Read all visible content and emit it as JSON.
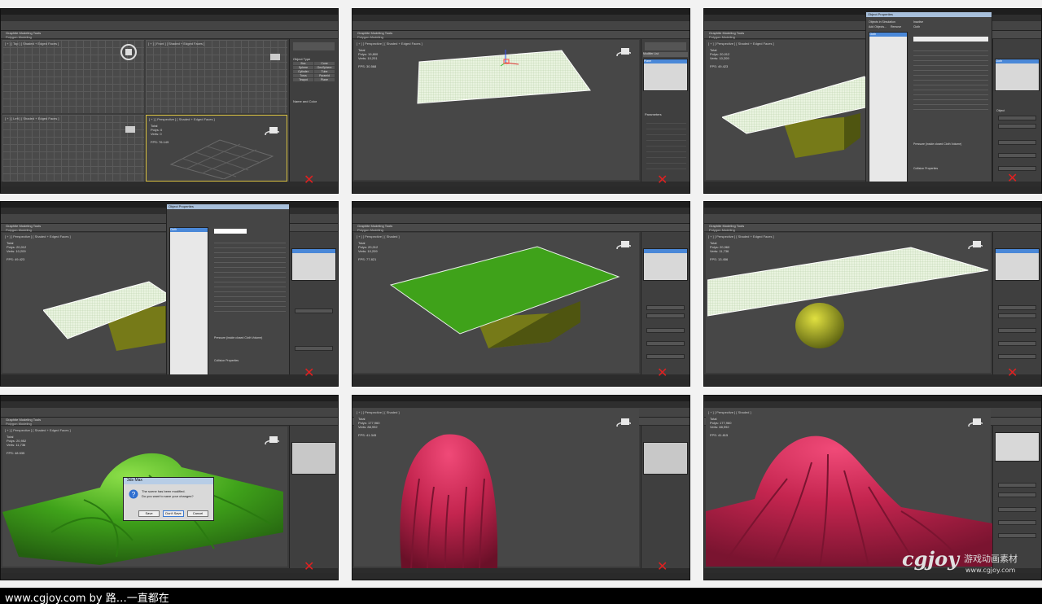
{
  "caption": "www.cgjoy.com by 路…一直都在",
  "watermark": {
    "logo_text": "cgjoy",
    "cn_text": "游戏动画素材",
    "url": "www.cgjoy.com"
  },
  "ribbon": {
    "tab": "Graphite Modeling Tools",
    "sub": "Polygon Modeling"
  },
  "viewport_labels": {
    "top": "[ + ] [ Top ] [ Shaded + Edged Faces ]",
    "front": "[ + ] [ Front ] [ Shaded + Edged Faces ]",
    "left": "[ + ] [ Left ] [ Shaded + Edged Faces ]",
    "persp_edged": "[ + ] [ Perspective ] [ Shaded + Edged Faces ]",
    "persp_shaded": "[ + ] [ Perspective ] [ Shaded ]"
  },
  "stats": {
    "t1": "Total\nPolys: 0\nVerts: 0\n\nFPS: 76.149",
    "t2": "Total\nPolys: 19,800\nVerts: 10,201\n\nFPS: 30.568",
    "t3": "Total\nPolys: 20,012\nVerts: 10,209\n\nFPS: 49.423",
    "t4": "Total\nPolys: 20,012\nVerts: 10,209\n\nFPS: 49.423",
    "t5": "Total\nPolys: 20,012\nVerts: 10,209\n\nFPS: 77.821",
    "t6": "Total\nPolys: 20,960\nVerts: 11,736\n\nFPS: 13.456",
    "t7": "Total\nPolys: 20,952\nVerts: 11,736\n\nFPS: 48.535",
    "t8": "Total\nPolys: 177,960\nVerts: 88,992\n\nFPS: 41.345",
    "t9": "Total\nPolys: 177,960\nVerts: 88,992\n\nFPS: 41.815"
  },
  "panel": {
    "object_type": "Object Type",
    "name_color": "Name and Color",
    "parameters": "Parameters",
    "modifier_list": "Modifier List",
    "object": "Object",
    "object_properties": "Object Properties",
    "cloth_forces": "Cloth Forces",
    "simulation": "Simulation",
    "simulate_local": "Simulate Local",
    "simulate": "Simulate",
    "erase_simulation": "Erase Simulation",
    "selected_object_manip": "Selected Object Manip",
    "delete_object_cache": "Delete Object Cache",
    "cloth": "Cloth",
    "plane": "Plane",
    "primitives": [
      "Box",
      "Cone",
      "Sphere",
      "GeoSphere",
      "Cylinder",
      "Tube",
      "Torus",
      "Pyramid",
      "Teapot",
      "Plane"
    ]
  },
  "obj_props": {
    "title": "Object Properties",
    "objects_in_sim": "Objects in Simulation",
    "add_objects": "Add Objects...",
    "remove": "Remove",
    "cloth_option": "Cloth",
    "collision_option": "Collision Object",
    "inactive": "Inactive",
    "presets": "Presets",
    "cloth_properties": "Cloth Properties",
    "load": "Load",
    "save": "Save",
    "props": [
      "U Bend",
      "V Bend",
      "U B-Curve",
      "V B-Curve",
      "U Stretch",
      "V Stretch",
      "Shear",
      "Density",
      "Damping",
      "Plasticity",
      "Thickness",
      "Repulsion",
      "Air Res.",
      "Dyn. Fric.",
      "Static Fric.",
      "Self Fric.",
      "Seam Force",
      "U Scale",
      "V Scale",
      "Depth",
      "Offset",
      "Cling"
    ],
    "pressure": "Pressure (inside closed Cloth Volume)",
    "collision_props": "Collision Properties",
    "ok": "OK",
    "cancel": "Cancel"
  },
  "dialog": {
    "title": "3ds Max",
    "msg1": "The scene has been modified.",
    "msg2": "Do you want to save your changes?",
    "save": "Save",
    "dont_save": "Don't Save",
    "cancel": "Cancel"
  },
  "colors": {
    "viewport_bg": "#474747",
    "green": "#3fa21a",
    "crimson": "#c4254f",
    "red_x": "#e02020"
  }
}
